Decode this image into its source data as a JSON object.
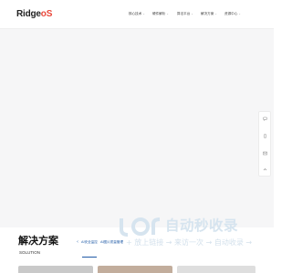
{
  "header": {
    "logo_text": "Ridge",
    "logo_accent": "S",
    "logo_middle": "o",
    "nav": [
      {
        "label": "核心技术",
        "has_dropdown": true
      },
      {
        "label": "硬件解析",
        "has_dropdown": true
      },
      {
        "label": "算法平台",
        "has_dropdown": true
      },
      {
        "label": "解决方案",
        "has_dropdown": true
      },
      {
        "label": "资源中心",
        "has_dropdown": true
      }
    ]
  },
  "side_tools": [
    {
      "icon": "message-icon"
    },
    {
      "icon": "phone-icon"
    },
    {
      "icon": "mail-icon"
    },
    {
      "icon": "arrow-up-icon"
    }
  ],
  "watermark": {
    "title": "自动秒收录",
    "subtitle": "+ 放上链接 → 来访一次 → 自动收录 →"
  },
  "solution": {
    "title": "解决方案",
    "subtitle": "SOLUTION",
    "tabs": [
      {
        "label": "AI安全监控"
      },
      {
        "label": "AI图片质量管理"
      }
    ]
  },
  "colors": {
    "accent": "#e8473a",
    "link_blue": "#1f5aa6",
    "watermark": "#d6e4ef"
  }
}
